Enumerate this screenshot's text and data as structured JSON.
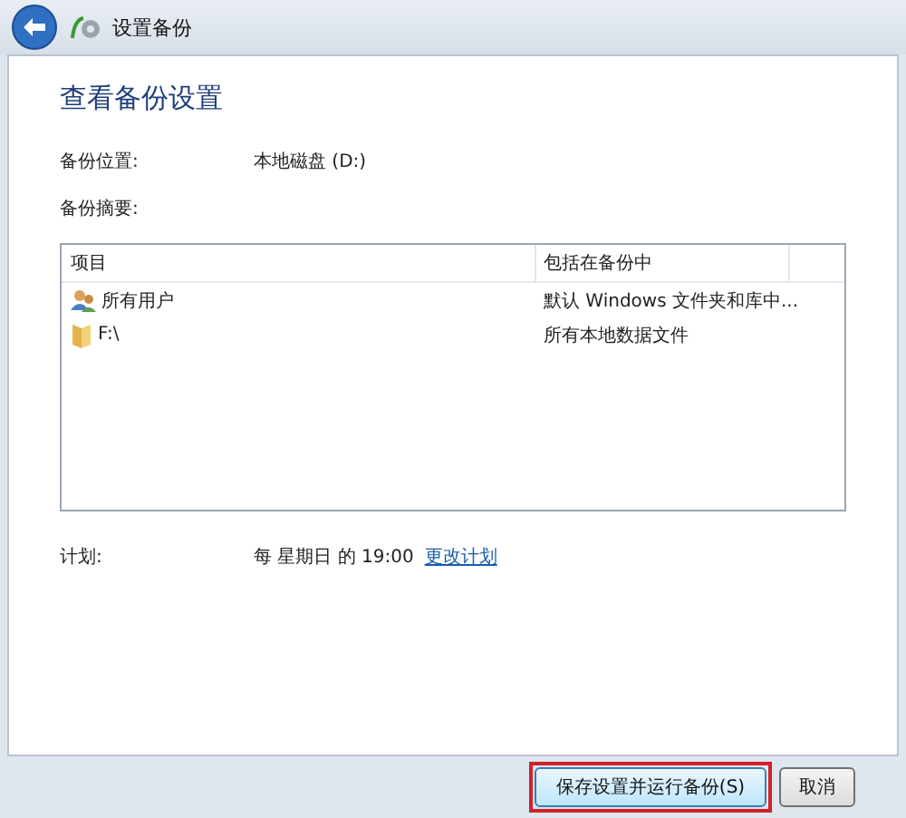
{
  "window": {
    "title": "设置备份"
  },
  "heading": "查看备份设置",
  "location": {
    "label": "备份位置:",
    "value": "本地磁盘 (D:)"
  },
  "summary": {
    "label": "备份摘要:"
  },
  "table": {
    "columns": [
      "项目",
      "包括在备份中"
    ],
    "rows": [
      {
        "kind": "users",
        "item": "所有用户",
        "included": "默认 Windows 文件夹和库中..."
      },
      {
        "kind": "folder",
        "item": "F:\\",
        "included": "所有本地数据文件"
      }
    ]
  },
  "schedule": {
    "label": "计划:",
    "value": "每 星期日 的 19:00",
    "link": "更改计划"
  },
  "buttons": [
    {
      "label": "保存设置并运行备份(S)",
      "highlighted": true
    },
    {
      "label": "取消",
      "highlighted": false
    }
  ]
}
